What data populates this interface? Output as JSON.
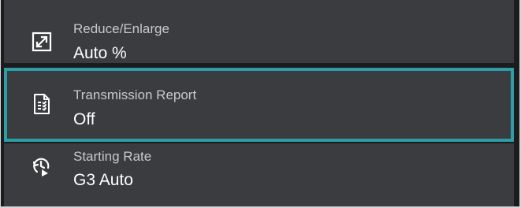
{
  "settings": {
    "items": [
      {
        "label": "Reduce/Enlarge",
        "value": "Auto %",
        "icon": "resize-icon",
        "selected": false
      },
      {
        "label": "Transmission Report",
        "value": "Off",
        "icon": "report-document-icon",
        "selected": true
      },
      {
        "label": "Starting Rate",
        "value": "G3 Auto",
        "icon": "rate-clock-icon",
        "selected": false
      }
    ]
  },
  "colors": {
    "background": "#1b1c1e",
    "panel": "#3b3c3f",
    "selected_border": "#2d9da6",
    "label_text": "#c9c9cb",
    "value_text": "#ffffff"
  }
}
